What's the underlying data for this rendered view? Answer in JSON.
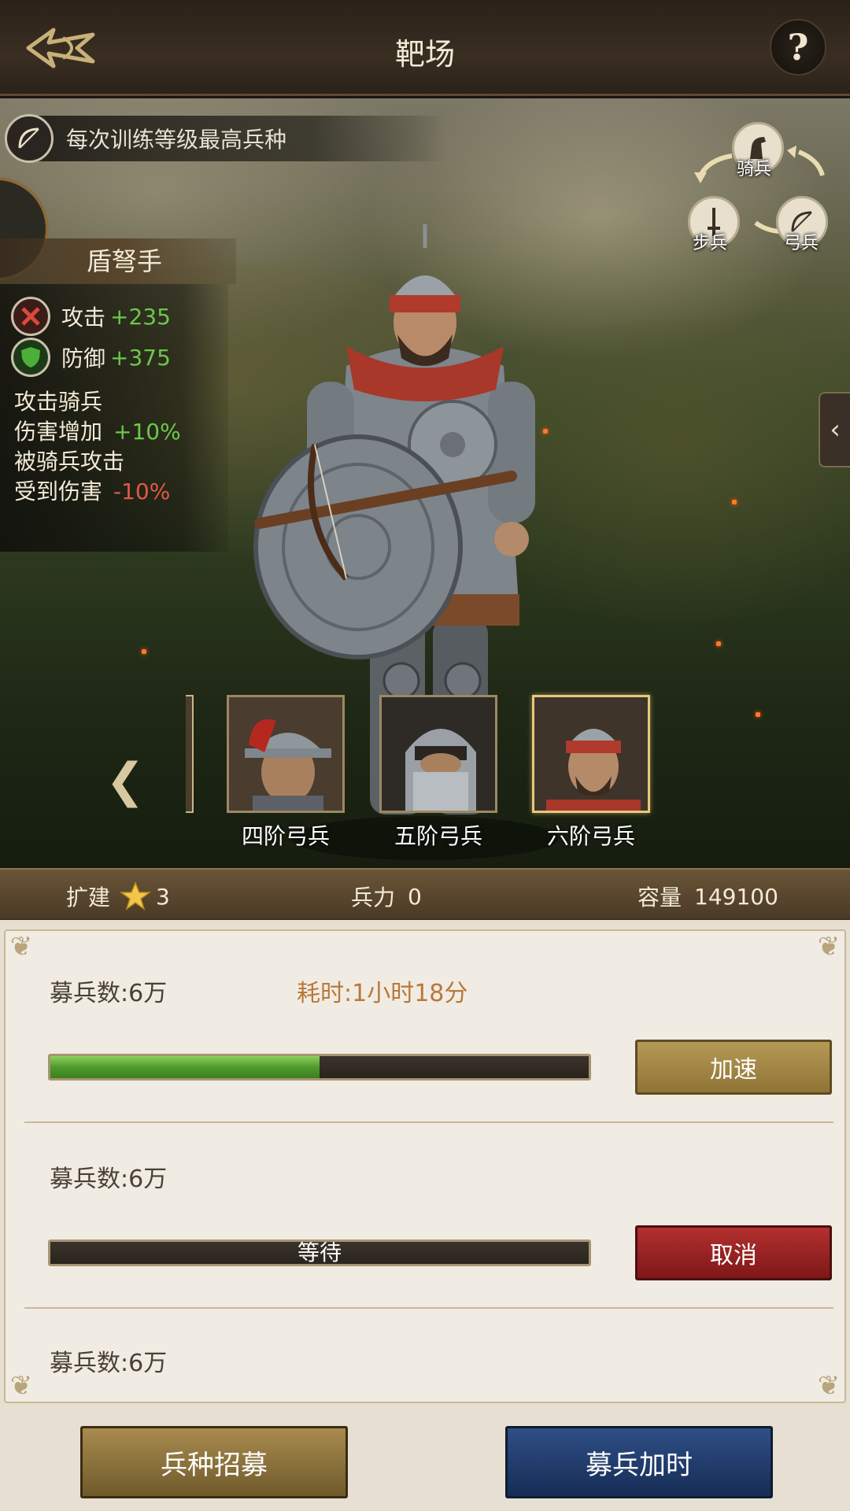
{
  "header": {
    "title": "靶场",
    "help_label": "?"
  },
  "info_bar": {
    "text": "每次训练等级最高兵种"
  },
  "unit": {
    "name": "盾弩手",
    "stats": [
      {
        "label": "攻击",
        "value": "+235",
        "icon": "sword-crossed-icon",
        "color": "#c94a3a"
      },
      {
        "label": "防御",
        "value": "+375",
        "icon": "shield-icon",
        "color": "#4caf3a"
      }
    ],
    "bonus": [
      {
        "label": "攻击骑兵",
        "value": ""
      },
      {
        "label": "伤害增加",
        "value": "+10%"
      },
      {
        "label": "被骑兵攻击",
        "value": ""
      },
      {
        "label": "受到伤害",
        "value": "-10%"
      }
    ]
  },
  "counter_triangle": {
    "cavalry": "骑兵",
    "infantry": "步兵",
    "archer": "弓兵"
  },
  "tiers": [
    {
      "label": "四阶弓兵"
    },
    {
      "label": "五阶弓兵"
    },
    {
      "label": "六阶弓兵"
    }
  ],
  "stat_bar": {
    "expand_label": "扩建",
    "expand_level": "3",
    "troops_label": "兵力",
    "troops_value": "0",
    "capacity_label": "容量",
    "capacity_value": "149100"
  },
  "queue": [
    {
      "title": "募兵数:6万",
      "time": "耗时:1小时18分",
      "progress": 0.5,
      "action": "加速"
    },
    {
      "title": "募兵数:6万",
      "status": "等待",
      "progress": 0,
      "action": "取消"
    },
    {
      "title": "募兵数:6万"
    }
  ],
  "buttons": {
    "recruit": "兵种招募",
    "extend": "募兵加时"
  }
}
